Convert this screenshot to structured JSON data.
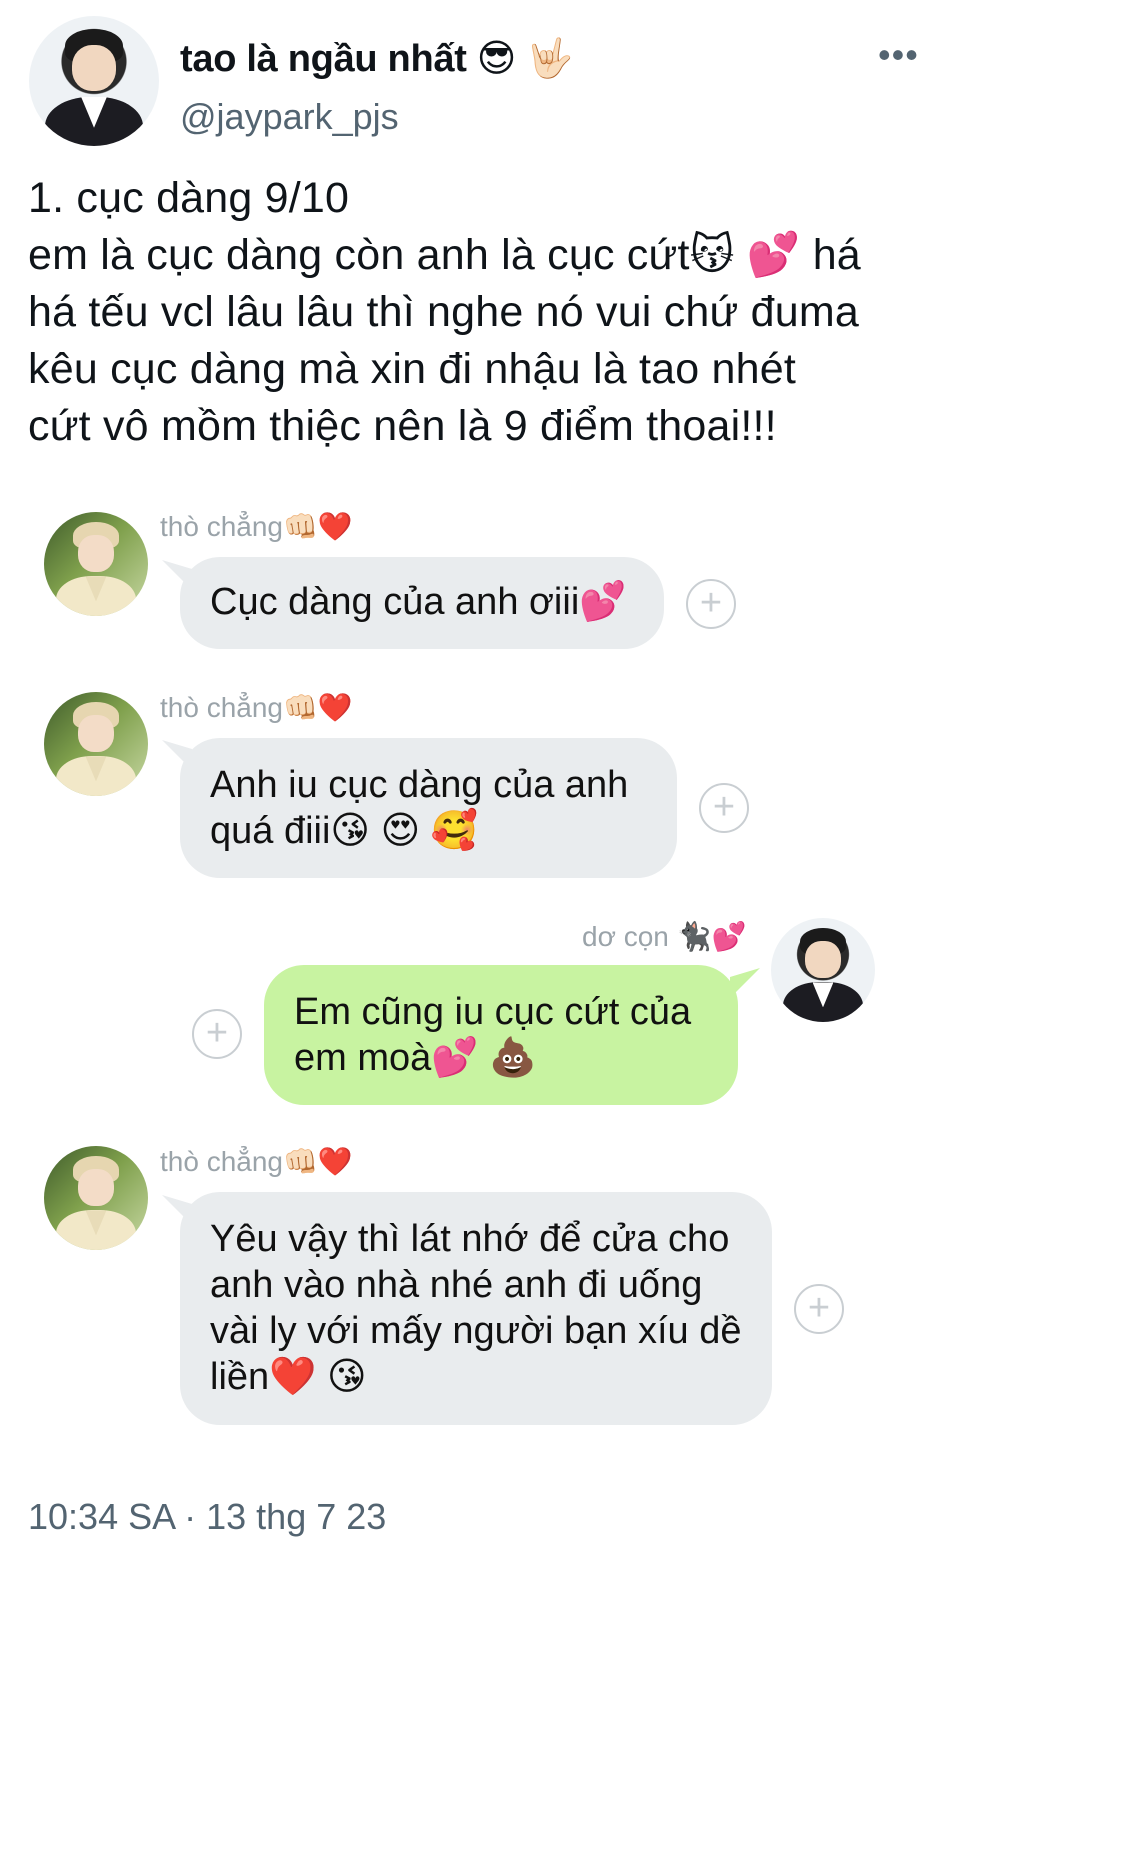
{
  "post": {
    "display_name": "tao là ngầu nhất 😎 🤟🏻",
    "handle": "@jaypark_pjs",
    "more_icon": "more-horizontal-icon",
    "text_lines": [
      "1. cục dàng  9/10",
      "em là cục dàng còn anh là cục cứt😽 💕 há",
      "há tếu vcl lâu lâu thì nghe nó vui chứ đuma",
      "kêu cục dàng mà xin đi nhậu là tao nhét",
      "cứt vô mồm thiệc nên là 9 điểm thoai!!!"
    ],
    "timestamp": "10:34 SA · 13 thg 7 23"
  },
  "chat": {
    "messages": [
      {
        "sender": "thò chẳng👊🏻❤️",
        "text": "Cục dàng của anh ơiii💕"
      },
      {
        "sender": "thò chẳng👊🏻❤️",
        "text_lines": [
          "Anh iu cục dàng của anh",
          "quá điii😘 😍 🥰"
        ]
      },
      {
        "sender": "dơ cọn 🐈‍⬛💕",
        "text_lines": [
          "Em cũng iu cục cứt của",
          "em moà💕 💩"
        ]
      },
      {
        "sender": "thò chẳng👊🏻❤️",
        "text_lines": [
          "Yêu vậy thì lát nhớ để cửa cho",
          "anh vào nhà nhé anh đi uống",
          "vài ly với mấy người bạn xíu dề",
          "liền❤️ 😘"
        ]
      }
    ],
    "plus_symbol": "+"
  },
  "colors": {
    "gray_bubble": "#e9ecee",
    "green_bubble": "#c8f3a1",
    "secondary_text": "#536471",
    "sender_text": "#9aa3a9"
  }
}
